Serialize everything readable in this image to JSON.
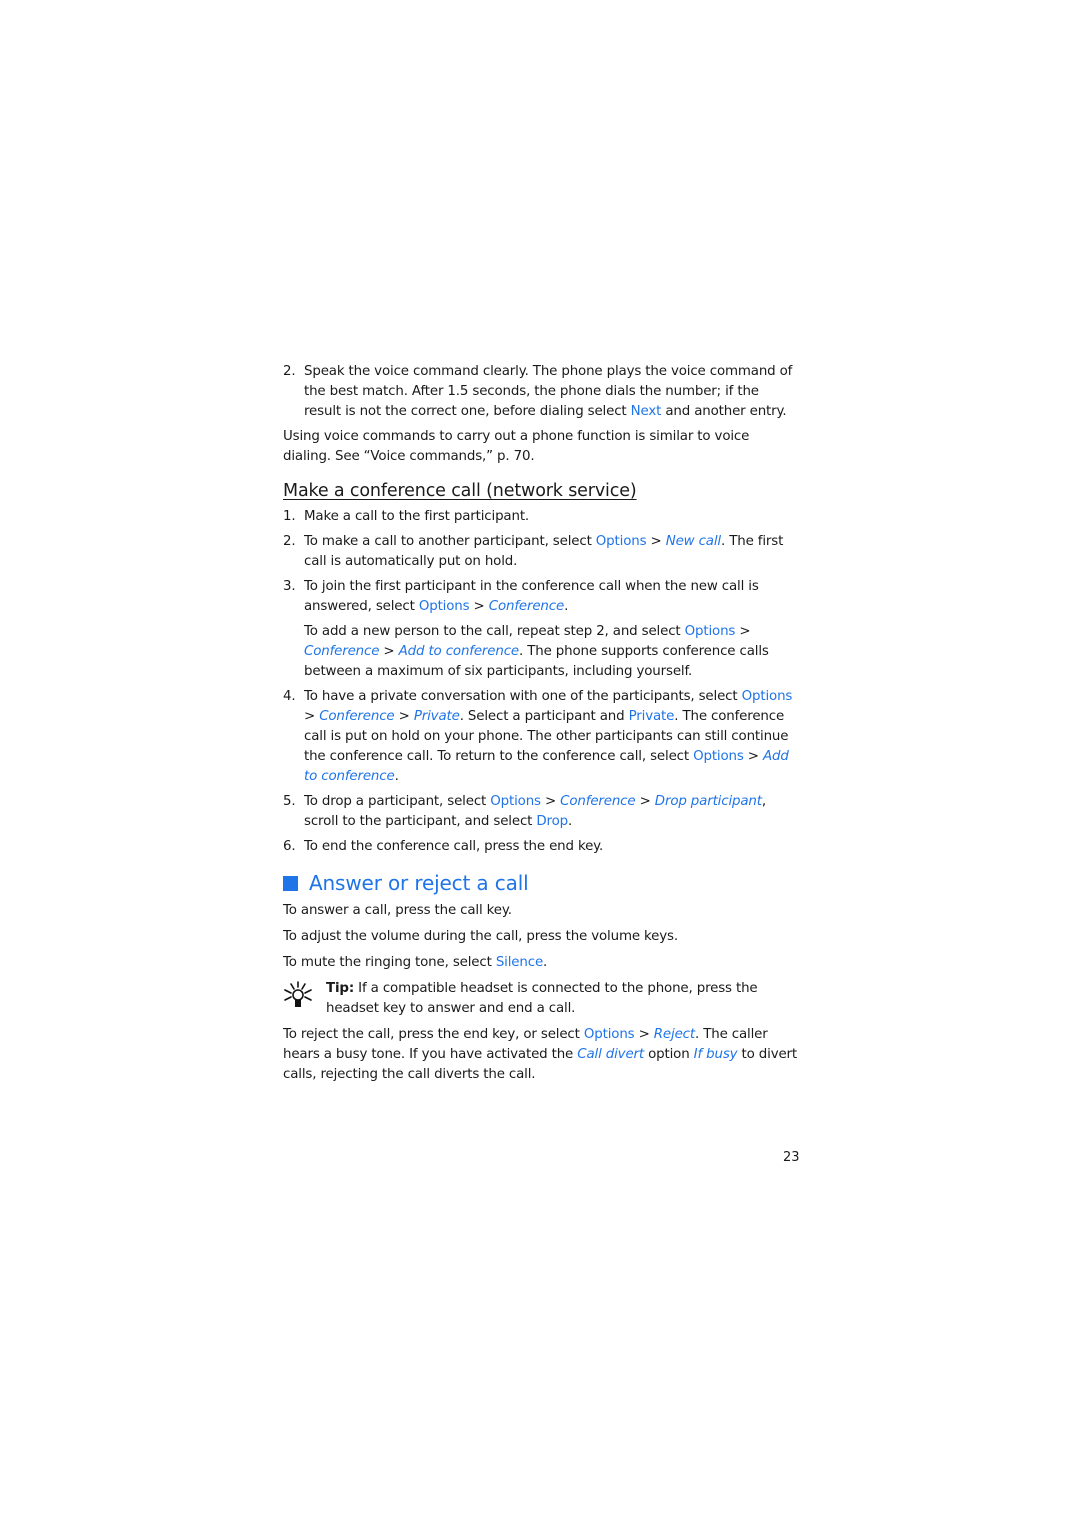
{
  "intro": {
    "step2": {
      "num": "2.",
      "t1": "Speak the voice command clearly. The phone plays the voice command of the best match. After 1.5 seconds, the phone dials the number; if the result is not the correct one, before dialing select ",
      "next": "Next",
      "t2": " and another entry."
    },
    "para": "Using voice commands to carry out a phone function is similar to voice dialing. See “Voice commands,” p. 70."
  },
  "conference": {
    "heading": "Make a conference call (network service)",
    "s1": {
      "num": "1.",
      "text": "Make a call to the first participant."
    },
    "s2": {
      "num": "2.",
      "t1": "To make a call to another participant, select ",
      "options": "Options",
      "gt": " > ",
      "newcall": "New call",
      "t2": ". The first call is automatically put on hold."
    },
    "s3": {
      "num": "3.",
      "t1": "To join the first participant in the conference call when the new call is answered, select ",
      "options": "Options",
      "gt": " > ",
      "conference": "Conference",
      "t2": ".",
      "c1": "To add a new person to the call, repeat step 2, and select ",
      "c_options": "Options",
      "c_conference": "Conference",
      "c_add": "Add to conference",
      "c2": ". The phone supports conference calls between a maximum of six participants, including yourself."
    },
    "s4": {
      "num": "4.",
      "t1": "To have a private conversation with one of the participants, select ",
      "options": "Options",
      "conference": "Conference",
      "private_i": "Private",
      "t2": ". Select a participant and ",
      "private_b": "Private",
      "t3": ". The conference call is put on hold on your phone. The other participants can still continue the conference call. To return to the conference call, select ",
      "options2": "Options",
      "add": "Add to conference",
      "t4": "."
    },
    "s5": {
      "num": "5.",
      "t1": "To drop a participant, select ",
      "options": "Options",
      "conference": "Conference",
      "drop_participant": "Drop participant",
      "t2": ", scroll to the participant, and select ",
      "drop": "Drop",
      "t3": "."
    },
    "s6": {
      "num": "6.",
      "text": "To end the conference call, press the end key."
    }
  },
  "answer": {
    "heading": "Answer or reject a call",
    "p1": "To answer a call, press the call key.",
    "p2": "To adjust the volume during the call, press the volume keys.",
    "p3a": "To mute the ringing tone, select ",
    "silence": "Silence",
    "p3b": ".",
    "tip_label": "Tip:",
    "tip_text": " If a compatible headset is connected to the phone, press the headset key to answer and end a call.",
    "r1": "To reject the call, press the end key, or select ",
    "options": "Options",
    "reject": "Reject",
    "r2": ". The caller hears a busy tone. If you have activated the ",
    "calldivert": "Call divert",
    "r3": " option ",
    "ifbusy": "If busy",
    "r4": " to divert calls, rejecting the call diverts the call."
  },
  "gt": " > ",
  "page_number": "23",
  "colors": {
    "accent": "#1f74e8",
    "text": "#1a1a1a"
  }
}
